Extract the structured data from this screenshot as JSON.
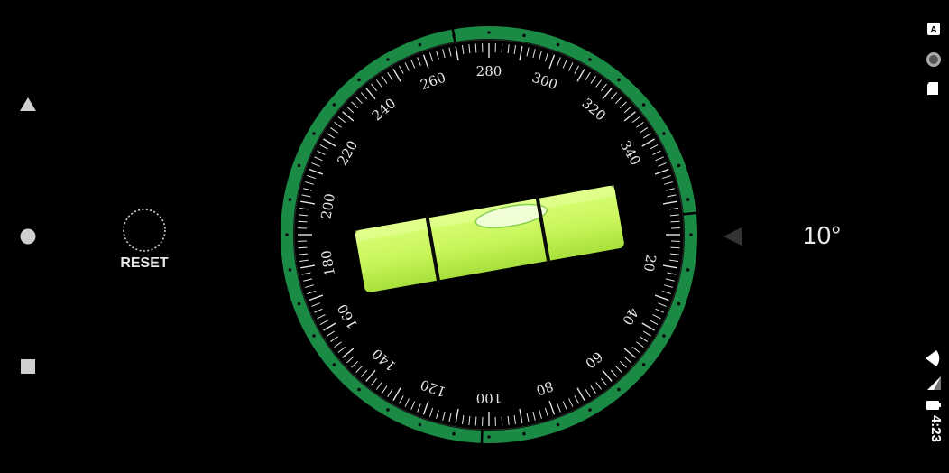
{
  "nav": {
    "back_icon": "triangle-back-icon",
    "home_icon": "circle-home-icon",
    "recents_icon": "square-recents-icon"
  },
  "reset": {
    "label": "RESET",
    "icon": "dashed-circle-icon"
  },
  "level": {
    "angle_readout": "10°",
    "dial_labels": [
      "20",
      "40",
      "60",
      "80",
      "100",
      "120",
      "140",
      "160",
      "180",
      "200",
      "220",
      "240",
      "260",
      "280",
      "300",
      "320",
      "340"
    ],
    "bubble_color": "#c8f55a",
    "ring_color": "#1a8a45"
  },
  "status": {
    "time": "4:23",
    "icons": [
      "a-icon",
      "circle-indicator-icon",
      "sd-card-icon",
      "wifi-icon",
      "signal-icon",
      "battery-icon"
    ]
  }
}
